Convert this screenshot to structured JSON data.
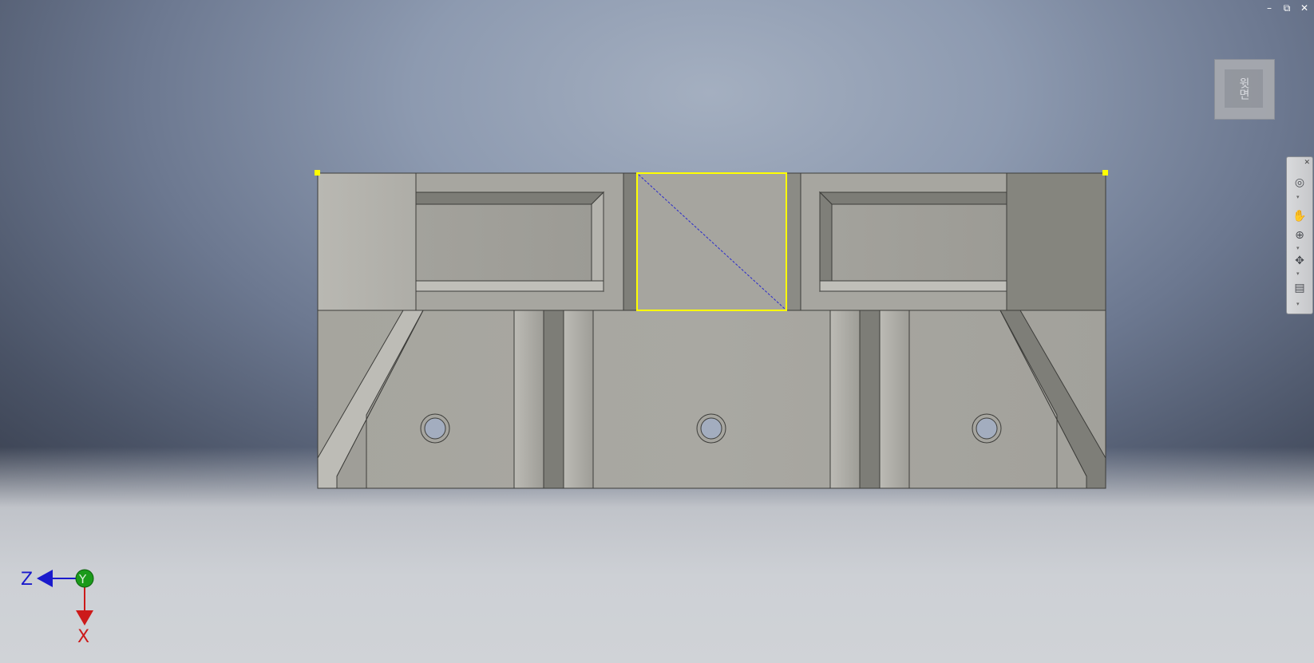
{
  "window": {
    "minimize": "–",
    "restore": "⧉",
    "close": "✕"
  },
  "viewcube": {
    "face_label": "윗면"
  },
  "navbar": {
    "close": "✕",
    "tools": [
      {
        "icon": "steering-wheel-icon",
        "glyph": "◎"
      },
      {
        "icon": "pan-hand-icon",
        "glyph": "✋"
      },
      {
        "icon": "zoom-icon",
        "glyph": "⊕"
      },
      {
        "icon": "orbit-icon",
        "glyph": "✥"
      },
      {
        "icon": "look-at-icon",
        "glyph": "▤"
      }
    ],
    "more": "▾"
  },
  "triad": {
    "z_label": "Z",
    "y_label": "Y",
    "x_label": "X",
    "colors": {
      "z": "#1a1acc",
      "y": "#1a9a1a",
      "x": "#cc1a1a"
    }
  },
  "colors": {
    "selection": "#ffff00",
    "sketch_line": "#2a2acc",
    "part_face": "#a8a7a0",
    "part_dark": "#86867f",
    "part_light": "#bab9b3"
  }
}
